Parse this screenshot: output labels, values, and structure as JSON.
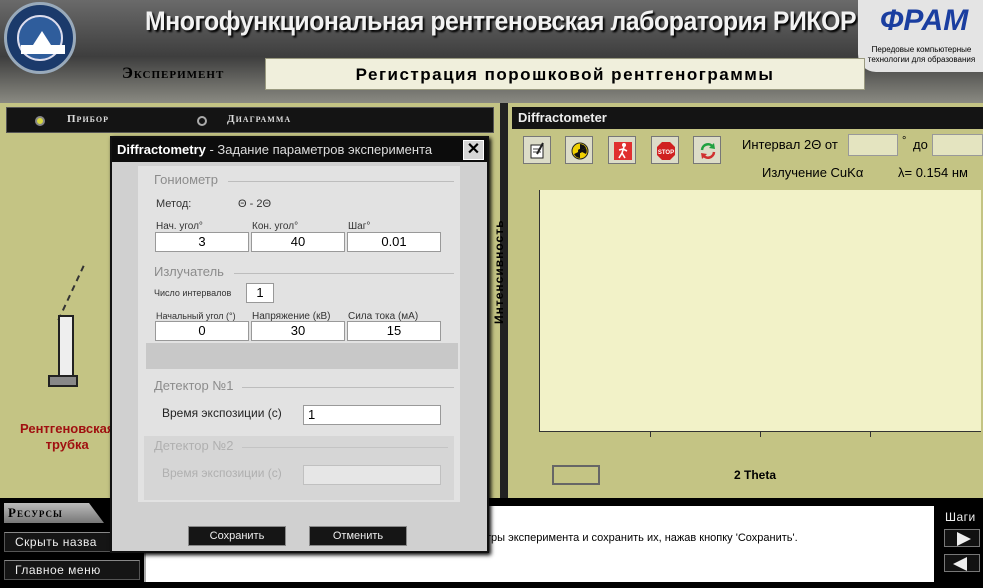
{
  "header": {
    "title": "Многофункциональная рентгеновская лаборатория РИКОР",
    "logo_text": "СЕВКАВГТУ",
    "brand_name": "ФРАМ",
    "brand_sub": "Передовые компьютерные технологии для образования",
    "section_label": "Эксперимент",
    "experiment_title": "Регистрация порошковой рентгенограммы"
  },
  "left_panel": {
    "tabs": [
      {
        "label": "Прибор",
        "selected": true
      },
      {
        "label": "Диаграмма",
        "selected": false
      }
    ],
    "tube_label_line1": "Рентгеновская",
    "tube_label_line2": "трубка"
  },
  "right_panel": {
    "title": "Diffractometer",
    "tools": [
      "notepad-icon",
      "radiation-icon",
      "walking-man-icon",
      "stop-icon",
      "refresh-icon"
    ],
    "interval_label": "Интервал 2Θ от",
    "interval_from": "",
    "deg_sign": "°",
    "to_label": "до",
    "interval_to": "",
    "radiation_label": "Излучение CuKα",
    "lambda_label": "λ= 0.154 нм",
    "y_axis_label": "Интенсивность",
    "x_axis_label": "2 Theta"
  },
  "dialog": {
    "title_bold": "Diffractometry",
    "title_rest": " - Задание параметров эксперимента",
    "close_label": "✕",
    "goniometer": {
      "section": "Гониометр",
      "method_label": "Метод:",
      "method_value": "Θ - 2Θ",
      "start_angle_label": "Нач. угол°",
      "start_angle": "3",
      "end_angle_label": "Кон. угол°",
      "end_angle": "40",
      "step_label": "Шаг°",
      "step": "0.01"
    },
    "emitter": {
      "section": "Излучатель",
      "intervals_label": "Число интервалов",
      "intervals": "1",
      "initial_angle_label": "Начальный угол (°)",
      "initial_angle": "0",
      "voltage_label": "Напряжение (кВ)",
      "voltage": "30",
      "current_label": "Сила тока (мА)",
      "current": "15"
    },
    "detector1": {
      "section": "Детектор №1",
      "exposure_label": "Время экспозиции (с)",
      "exposure": "1"
    },
    "detector2": {
      "section": "Детектор №2",
      "exposure_label": "Время экспозиции (с)",
      "exposure": ""
    },
    "save_label": "Сохранить",
    "cancel_label": "Отменить"
  },
  "bottom": {
    "resources_label": "Ресурсы",
    "hide_names_label": "Скрыть назва",
    "main_menu_label": "Главное меню",
    "message": "тры эксперимента и сохранить их, нажав кнопку 'Сохранить'.",
    "steps_label": "Шаги"
  },
  "colors": {
    "panel_olive": "#c4c484",
    "plot_bg": "#f2f2c8",
    "tube_label": "#a01010",
    "brand_blue": "#1a3ea0"
  }
}
